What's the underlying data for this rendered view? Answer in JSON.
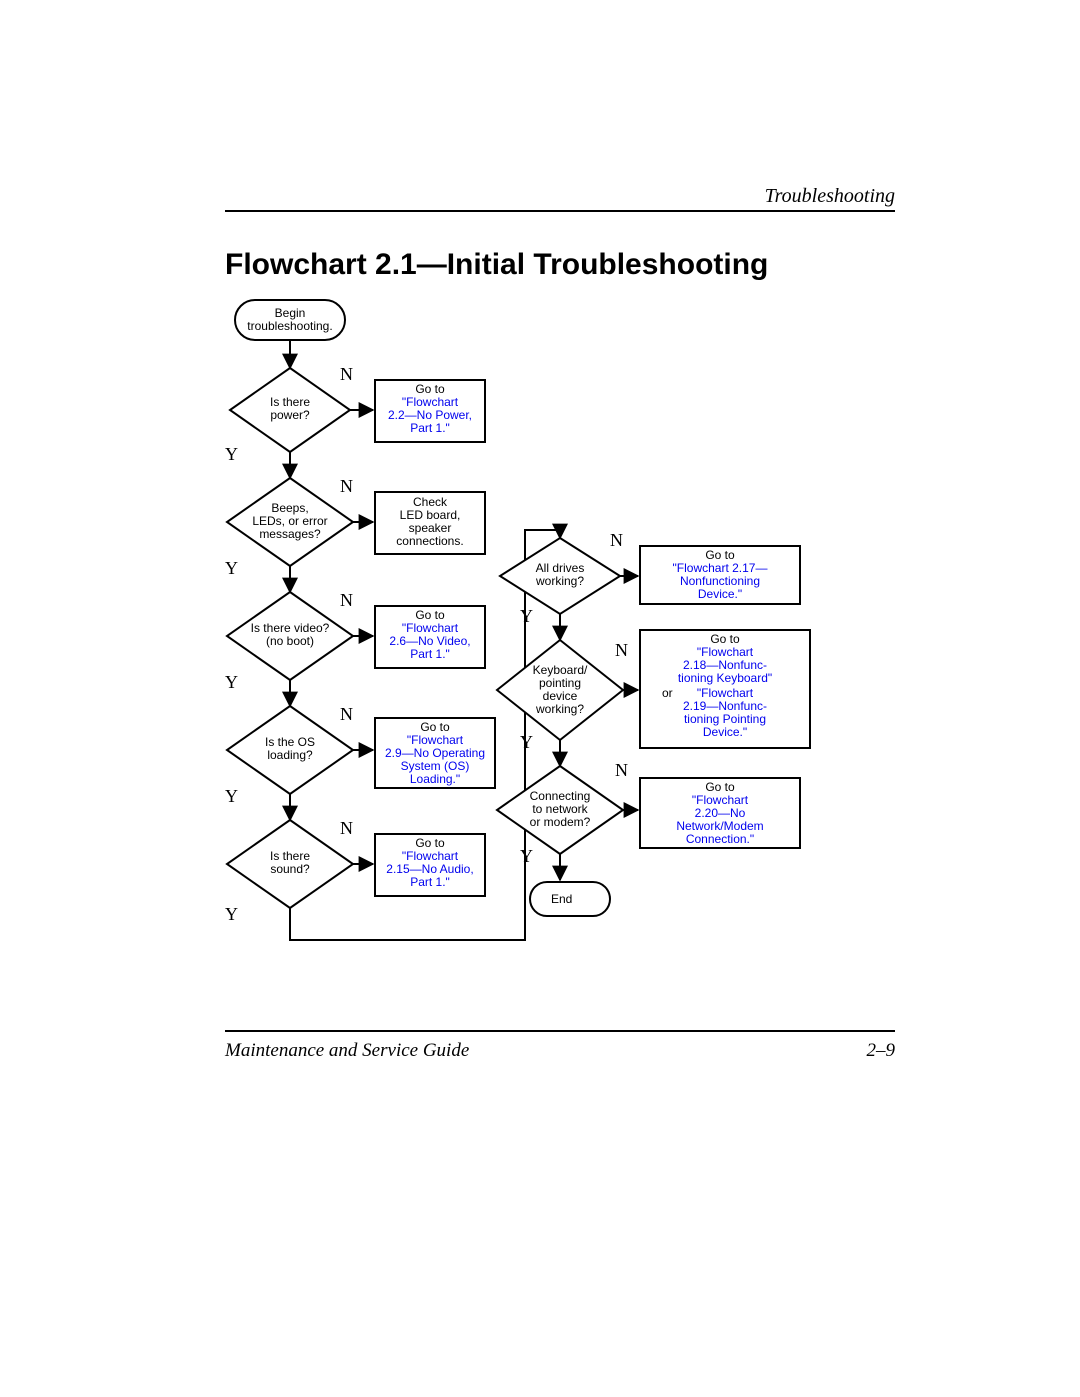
{
  "header": {
    "section": "Troubleshooting"
  },
  "title": "Flowchart 2.1—Initial Troubleshooting",
  "footer": {
    "left": "Maintenance and Service Guide",
    "right": "2–9"
  },
  "labels": {
    "yes": "Y",
    "no": "N"
  },
  "nodes": {
    "start": "Begin\ntroubleshooting.",
    "q_power": "Is there\npower?",
    "a_power": {
      "pre": "Go to",
      "link": "\"Flowchart\n2.2—No Power,\nPart 1.\""
    },
    "q_beeps": "Beeps,\nLEDs, or error\nmessages?",
    "a_beeps": "Check\nLED board,\nspeaker\nconnections.",
    "q_video": "Is there video?\n(no boot)",
    "a_video": {
      "pre": "Go to",
      "link": "\"Flowchart\n2.6—No Video,\nPart 1.\""
    },
    "q_os": "Is the OS\nloading?",
    "a_os": {
      "pre": "Go to",
      "link": "\"Flowchart\n2.9—No Operating\nSystem (OS)\nLoading.\""
    },
    "q_sound": "Is there\nsound?",
    "a_sound": {
      "pre": "Go to",
      "link": "\"Flowchart\n2.15—No Audio,\nPart 1.\""
    },
    "q_drives": "All drives\nworking?",
    "a_drives": {
      "pre": "Go to",
      "link": "\"Flowchart 2.17—\nNonfunctioning\nDevice.\""
    },
    "q_kbd": "Keyboard/\npointing\ndevice\nworking?",
    "a_kbd": {
      "pre": "Go to",
      "link1": "\"Flowchart\n2.18—Nonfunc-\ntioning Keyboard\"",
      "mid": " or ",
      "link2": "\"Flowchart\n2.19—Nonfunc-\ntioning Pointing\nDevice.\""
    },
    "q_net": "Connecting\nto network\nor modem?",
    "a_net": {
      "pre": "Go to",
      "link": "\"Flowchart\n2.20—No\nNetwork/Modem\nConnection.\""
    },
    "end": "End"
  },
  "chart_data": {
    "type": "flowchart",
    "nodes": [
      {
        "id": "start",
        "shape": "terminator",
        "text": "Begin troubleshooting."
      },
      {
        "id": "q_power",
        "shape": "decision",
        "text": "Is there power?"
      },
      {
        "id": "a_power",
        "shape": "process",
        "text": "Go to \"Flowchart 2.2—No Power, Part 1.\""
      },
      {
        "id": "q_beeps",
        "shape": "decision",
        "text": "Beeps, LEDs, or error messages?"
      },
      {
        "id": "a_beeps",
        "shape": "process",
        "text": "Check LED board, speaker connections."
      },
      {
        "id": "q_video",
        "shape": "decision",
        "text": "Is there video? (no boot)"
      },
      {
        "id": "a_video",
        "shape": "process",
        "text": "Go to \"Flowchart 2.6—No Video, Part 1.\""
      },
      {
        "id": "q_os",
        "shape": "decision",
        "text": "Is the OS loading?"
      },
      {
        "id": "a_os",
        "shape": "process",
        "text": "Go to \"Flowchart 2.9—No Operating System (OS) Loading.\""
      },
      {
        "id": "q_sound",
        "shape": "decision",
        "text": "Is there sound?"
      },
      {
        "id": "a_sound",
        "shape": "process",
        "text": "Go to \"Flowchart 2.15—No Audio, Part 1.\""
      },
      {
        "id": "q_drives",
        "shape": "decision",
        "text": "All drives working?"
      },
      {
        "id": "a_drives",
        "shape": "process",
        "text": "Go to \"Flowchart 2.17—Nonfunctioning Device.\""
      },
      {
        "id": "q_kbd",
        "shape": "decision",
        "text": "Keyboard/pointing device working?"
      },
      {
        "id": "a_kbd",
        "shape": "process",
        "text": "Go to \"Flowchart 2.18—Nonfunctioning Keyboard\" or \"Flowchart 2.19—Nonfunctioning Pointing Device.\""
      },
      {
        "id": "q_net",
        "shape": "decision",
        "text": "Connecting to network or modem?"
      },
      {
        "id": "a_net",
        "shape": "process",
        "text": "Go to \"Flowchart 2.20—No Network/Modem Connection.\""
      },
      {
        "id": "end",
        "shape": "terminator",
        "text": "End"
      }
    ],
    "edges": [
      {
        "from": "start",
        "to": "q_power"
      },
      {
        "from": "q_power",
        "to": "a_power",
        "label": "N"
      },
      {
        "from": "q_power",
        "to": "q_beeps",
        "label": "Y"
      },
      {
        "from": "q_beeps",
        "to": "a_beeps",
        "label": "N"
      },
      {
        "from": "q_beeps",
        "to": "q_video",
        "label": "Y"
      },
      {
        "from": "q_video",
        "to": "a_video",
        "label": "N"
      },
      {
        "from": "q_video",
        "to": "q_os",
        "label": "Y"
      },
      {
        "from": "q_os",
        "to": "a_os",
        "label": "N"
      },
      {
        "from": "q_os",
        "to": "q_sound",
        "label": "Y"
      },
      {
        "from": "q_sound",
        "to": "a_sound",
        "label": "N"
      },
      {
        "from": "q_sound",
        "to": "q_drives",
        "label": "Y"
      },
      {
        "from": "q_drives",
        "to": "a_drives",
        "label": "N"
      },
      {
        "from": "q_drives",
        "to": "q_kbd",
        "label": "Y"
      },
      {
        "from": "q_kbd",
        "to": "a_kbd",
        "label": "N"
      },
      {
        "from": "q_kbd",
        "to": "q_net",
        "label": "Y"
      },
      {
        "from": "q_net",
        "to": "a_net",
        "label": "N"
      },
      {
        "from": "q_net",
        "to": "end",
        "label": "Y"
      }
    ]
  }
}
